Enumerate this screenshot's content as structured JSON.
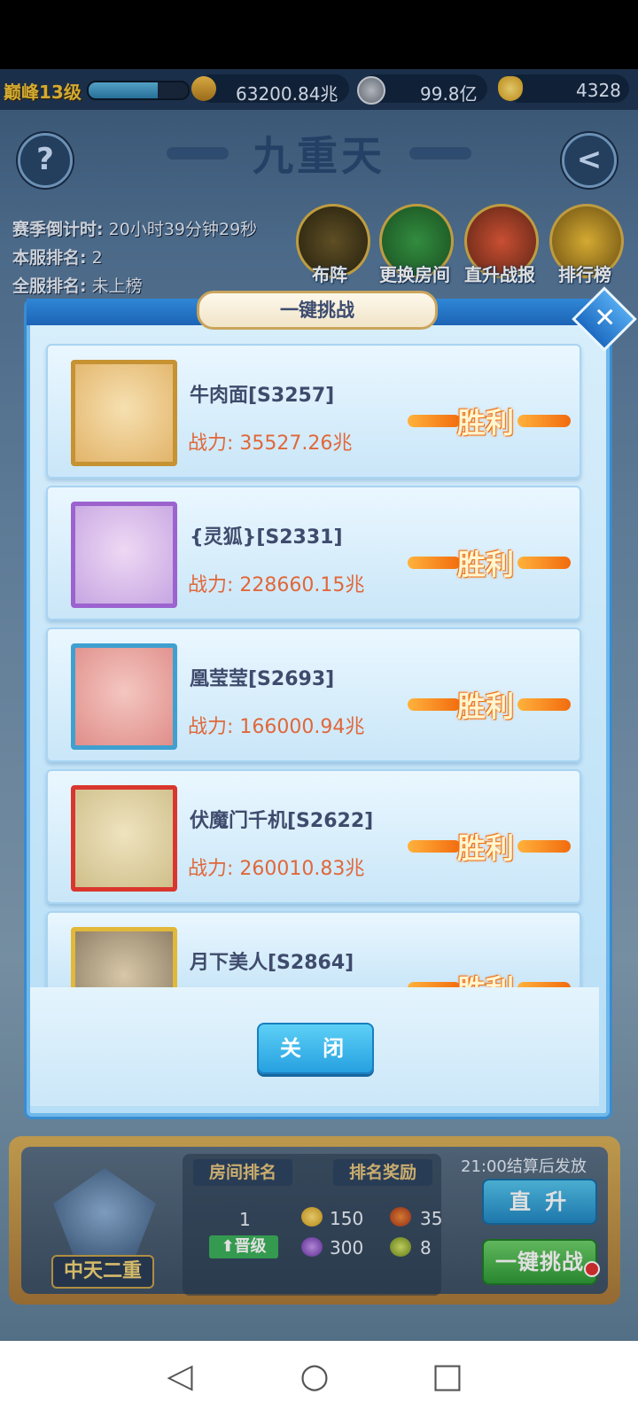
{
  "resources": {
    "level": "巅峰13级",
    "exp_progress": 0.7,
    "combat": "63200.84兆",
    "coin": "99.8亿",
    "ingot": "4328"
  },
  "header": {
    "title": "九重天",
    "help": "?",
    "back": "<"
  },
  "season": {
    "countdown_label": "赛季倒计时:",
    "countdown": "20小时39分钟29秒",
    "server_rank_label": "本服排名:",
    "server_rank": "2",
    "global_rank_label": "全服排名:",
    "global_rank": "未上榜"
  },
  "features": [
    "布阵",
    "更换房间",
    "直升战报",
    "排行榜"
  ],
  "modal": {
    "title": "一键挑战",
    "close_label": "关 闭",
    "power_prefix": "战力:",
    "result_label": "胜利",
    "opponents": [
      {
        "name": "牛肉面[S3257]",
        "power": "35527.26兆"
      },
      {
        "name": "{灵狐}[S2331]",
        "power": "228660.15兆"
      },
      {
        "name": "凰莹莹[S2693]",
        "power": "166000.94兆"
      },
      {
        "name": "伏魔门千机[S2622]",
        "power": "260010.83兆"
      },
      {
        "name": "月下美人[S2864]",
        "power": ""
      }
    ]
  },
  "panel": {
    "tier": "中天二重",
    "room_rank_header": "房间排名",
    "reward_header": "排名奖励",
    "room_rank": "1",
    "promote": "晋级",
    "rewards": [
      "150",
      "35",
      "300",
      "8"
    ],
    "settle_note": "21:00结算后发放",
    "direct_up": "直 升",
    "one_click": "一键挑战"
  },
  "colors": {
    "power": "#e0673a",
    "name": "#3f4b6c",
    "accent": "#26a0e0"
  }
}
